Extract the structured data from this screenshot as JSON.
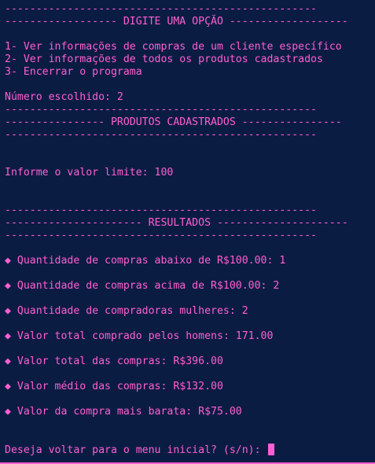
{
  "menu": {
    "rule_top": "--------------------------------------------------",
    "header": "------------------ DIGITE UMA OPÇÃO -------------------",
    "options": [
      "1- Ver informações de compras de um cliente específico",
      "2- Ver informações de todos os produtos cadastrados",
      "3- Encerrar o programa"
    ],
    "chosen": "Número escolhido: 2"
  },
  "products": {
    "rule_top": "--------------------------------------------------",
    "header": "---------------- PRODUTOS CADASTRADOS ----------------",
    "rule_bottom": "--------------------------------------------------",
    "limit_prompt": "Informe o valor limite: 100"
  },
  "results": {
    "rule_top": "--------------------------------------------------",
    "header": "---------------------- RESULTADOS ---------------------",
    "rule_bottom": "--------------------------------------------------",
    "items": [
      "◆ Quantidade de compras abaixo de R$100.00: 1",
      "◆ Quantidade de compras acima de R$100.00: 2",
      "◆ Quantidade de compradoras mulheres: 2",
      "◆ Valor total comprado pelos homens: 171.00",
      "◆ Valor total das compras: R$396.00",
      "◆ Valor médio das compras: R$132.00",
      "◆ Valor da compra mais barata: R$75.00"
    ]
  },
  "prompt": {
    "text": "Deseja voltar para o menu inicial? (s/n): "
  }
}
